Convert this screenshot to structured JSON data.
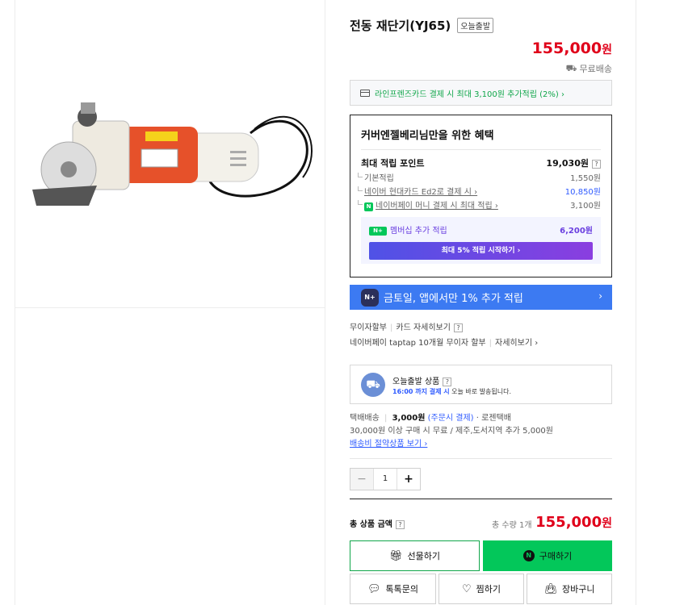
{
  "product": {
    "title": "전동 재단기(YJ65)",
    "badge": "오늘출발",
    "price": "155,000",
    "currency": "원",
    "shipping_note": "무료배송"
  },
  "card_promo": "라인프렌즈카드 결제 시 최대 3,100원 추가적립 (2%) ›",
  "benefits": {
    "title": "커버엔젤베리님만을 위한 혜택",
    "points_label": "최대 적립 포인트",
    "points_value": "19,030원",
    "rows": [
      {
        "label": "기본적립",
        "value": "1,550원"
      },
      {
        "label": "네이버 현대카드 Ed2로 결제 시 ›",
        "value": "10,850원"
      },
      {
        "label": "네이버페이 머니 결제 시 최대 적립 ›",
        "value": "3,100원"
      }
    ],
    "member_label": "멤버십 추가 적립",
    "member_value": "6,200원",
    "member_button": "최대 5% 적립 시작하기 ›"
  },
  "banner": {
    "icon": "N+",
    "text": "금토일, 앱에서만 1% 추가 적립",
    "arrow": "›"
  },
  "installment": {
    "line1_a": "무이자할부",
    "line1_b": "카드 자세히보기",
    "line2_a": "네이버페이 taptap 10개월 무이자 할부",
    "line2_b": "자세히보기 ›"
  },
  "today_ship": {
    "title": "오늘출발 상품",
    "sub_blue": "16:00 까지 결제 시",
    "sub_rest": " 오늘 바로 발송됩니다."
  },
  "ship_info": {
    "type": "택배배송",
    "fee": "3,000원",
    "fee_note": "(주문시 결제)",
    "carrier": "· 로젠택배",
    "line2": "30,000원 이상 구매 시 무료 / 제주,도서지역 추가 5,000원",
    "link": "배송비 절약상품 보기 ›"
  },
  "quantity": {
    "value": "1",
    "minus": "−",
    "plus": "+"
  },
  "total": {
    "label": "총 상품 금액",
    "qty_label": "총 수량 1개",
    "price": "155,000",
    "currency": "원"
  },
  "buttons": {
    "gift": "선물하기",
    "buy": "구매하기",
    "talk": "톡톡문의",
    "zzim": "찜하기",
    "cart": "장바구니"
  },
  "colors": {
    "price_red": "#e0001a",
    "naver_green": "#03c75a",
    "banner_blue": "#3c7af2",
    "member_purple": "#6a3fe0"
  }
}
